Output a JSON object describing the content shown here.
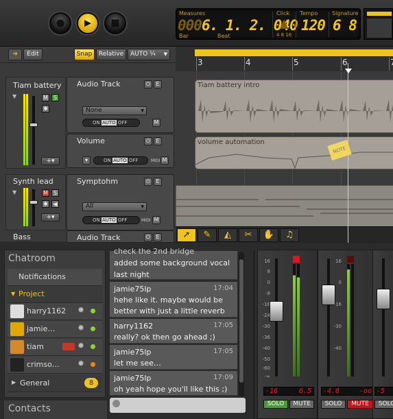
{
  "transport": {
    "record": "record",
    "play": "play",
    "stop": "stop"
  },
  "lcd": {
    "measures_label": "Measures",
    "bar_label": "Bar",
    "beat_label": "Beat",
    "measures_dim": "000",
    "measures_value": "6. 1. 2. 040",
    "click_label": "Click",
    "click_sub": "4 8 16",
    "tempo_label": "Tempo",
    "tempo_value": "120",
    "signature_label": "Signature",
    "signature_value": "6 8"
  },
  "toolbar": {
    "edit": "Edit",
    "snap": "Snap",
    "relative": "Relative",
    "auto": "AUTO ¼"
  },
  "timeline": {
    "ticks": [
      "3",
      "4",
      "5",
      "6",
      "7"
    ]
  },
  "tracks": [
    {
      "name": "Tiam battery",
      "module": "Audio Track",
      "dropdown": "None",
      "clip": "Tiam battery intro"
    },
    {
      "module": "Volume",
      "clip": "volume automation"
    },
    {
      "name": "Synth lead",
      "module": "Symptohm",
      "dropdown": "All"
    },
    {
      "name": "Bass",
      "module": "Audio Track"
    }
  ],
  "auto": {
    "on": "ON",
    "auto": "AUTO",
    "off": "OFF",
    "midi": "MIDI",
    "m": "M",
    "e": "E",
    "s": "S"
  },
  "note": "NOTE",
  "chatroom": {
    "title": "Chatroom",
    "notifications": "Notifications",
    "project": "Project",
    "general": "General",
    "general_badge": "8",
    "contacts": "Contacts",
    "users": [
      {
        "name": "harry1162"
      },
      {
        "name": "jamie…"
      },
      {
        "name": "tiam"
      },
      {
        "name": "crimso…"
      }
    ]
  },
  "chat": {
    "partial1": "check the 2nd bridge",
    "partial2": "added some background vocal",
    "partial3": "last night",
    "messages": [
      {
        "who": "jamie75lp",
        "ts": "17:04",
        "l1": "hehe like it. maybe would be",
        "l2": "better with just a little reverb"
      },
      {
        "who": "harry1162",
        "ts": "17:05",
        "l1": "really? ok then go ahead ;)"
      },
      {
        "who": "jamie75lp",
        "ts": "17:05",
        "l1": "let me see…"
      },
      {
        "who": "jamie75lp",
        "ts": "17:09",
        "l1": "oh yeah hope you'll like this ;)"
      }
    ]
  },
  "mixer": {
    "scale": [
      "16",
      "8",
      "0",
      "-8",
      "-16",
      "-24",
      "-30",
      "-36",
      "-40",
      "-50",
      "-60",
      "-∞"
    ],
    "strips": [
      {
        "l": "-16",
        "r": "6.5"
      },
      {
        "l": "-4.6",
        "r": "-oo"
      },
      {
        "l": "-5"
      }
    ],
    "solo": "SOLO",
    "mute": "MUTE"
  },
  "colors": {
    "accent": "#f0c419",
    "clip": "#a59f97"
  }
}
